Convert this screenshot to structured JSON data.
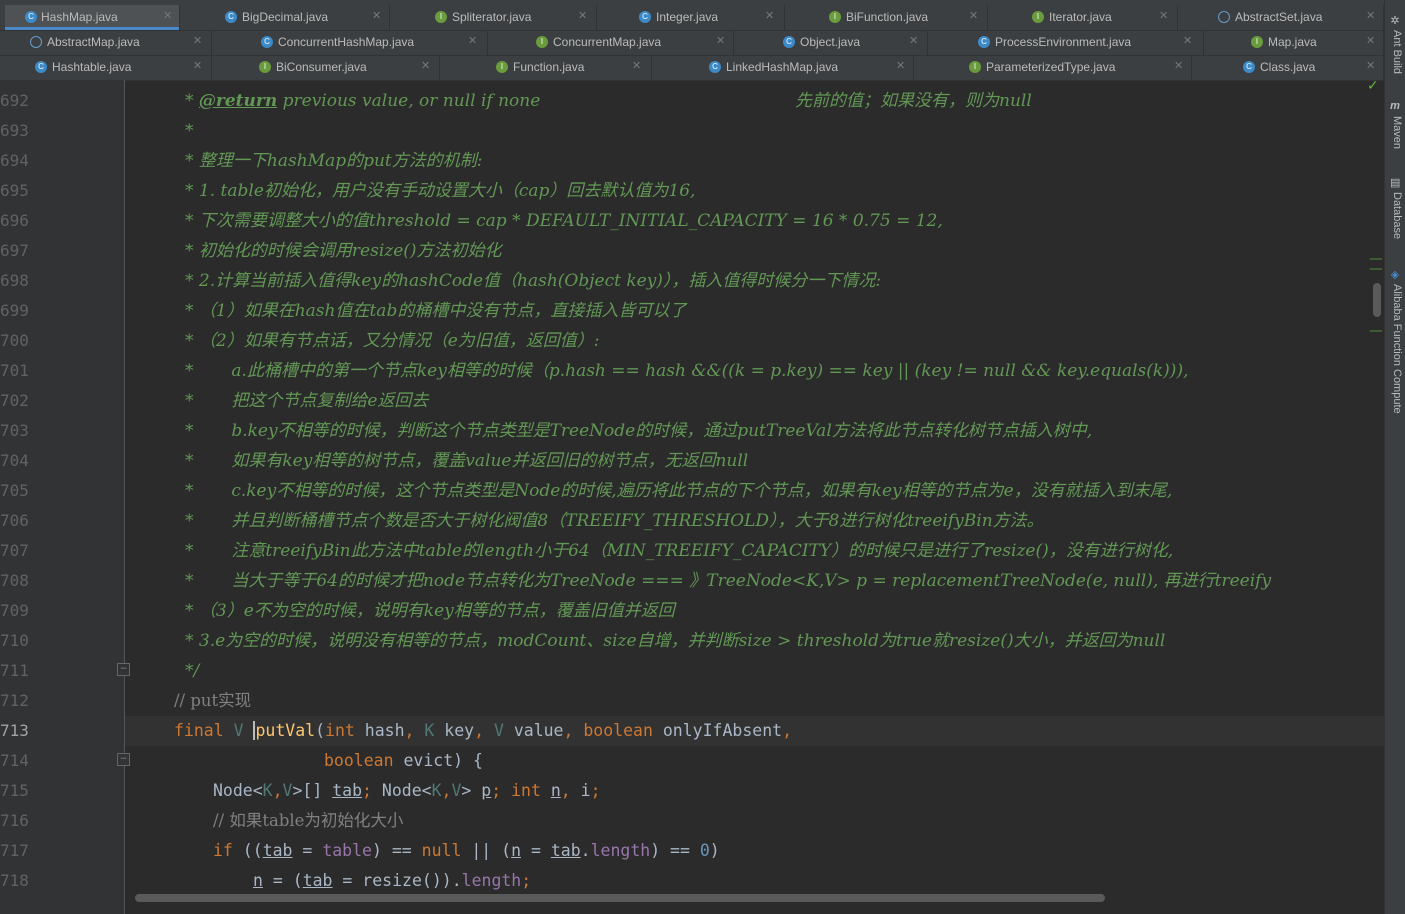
{
  "tabs": {
    "row1": [
      {
        "label": "HashMap.java",
        "icon": "class-icon",
        "active": true
      },
      {
        "label": "BigDecimal.java",
        "icon": "class-icon"
      },
      {
        "label": "Spliterator.java",
        "icon": "interface-icon"
      },
      {
        "label": "Integer.java",
        "icon": "class-icon"
      },
      {
        "label": "BiFunction.java",
        "icon": "interface-icon"
      },
      {
        "label": "Iterator.java",
        "icon": "interface-icon"
      },
      {
        "label": "AbstractSet.java",
        "icon": "abstract-class-icon"
      }
    ],
    "row2": [
      {
        "label": "AbstractMap.java",
        "icon": "abstract-class-icon"
      },
      {
        "label": "ConcurrentHashMap.java",
        "icon": "class-icon"
      },
      {
        "label": "ConcurrentMap.java",
        "icon": "interface-icon"
      },
      {
        "label": "Object.java",
        "icon": "class-icon"
      },
      {
        "label": "ProcessEnvironment.java",
        "icon": "class-icon"
      },
      {
        "label": "Map.java",
        "icon": "interface-icon"
      }
    ],
    "row3": [
      {
        "label": "Hashtable.java",
        "icon": "class-icon"
      },
      {
        "label": "BiConsumer.java",
        "icon": "interface-icon"
      },
      {
        "label": "Function.java",
        "icon": "interface-icon"
      },
      {
        "label": "LinkedHashMap.java",
        "icon": "class-icon"
      },
      {
        "label": "ParameterizedType.java",
        "icon": "interface-icon"
      },
      {
        "label": "Class.java",
        "icon": "class-icon"
      }
    ]
  },
  "tool_windows": [
    {
      "label": "Ant Build",
      "icon": "ant-icon"
    },
    {
      "label": "Maven",
      "icon": "maven-icon"
    },
    {
      "label": "Database",
      "icon": "database-icon"
    },
    {
      "label": "Alibaba Function Compute",
      "icon": "alibaba-icon"
    }
  ],
  "line_numbers": [
    "692",
    "693",
    "694",
    "695",
    "696",
    "697",
    "698",
    "699",
    "700",
    "701",
    "702",
    "703",
    "704",
    "705",
    "706",
    "707",
    "708",
    "709",
    "710",
    "711",
    "712",
    "713",
    "714",
    "715",
    "716",
    "717",
    "718"
  ],
  "current_line": "713",
  "doc_comment": {
    "l692_tag": "@return",
    "l692_text": " previous value, or null if none",
    "l692_cn": "先前的值；如果没有，则为null",
    "l693": "*",
    "l694": "* 整理一下hashMap的put方法的机制:",
    "l695": "* 1. table初始化，用户没有手动设置大小（cap）回去默认值为16,",
    "l696": "* 下次需要调整大小的值threshold = cap * DEFAULT_INITIAL_CAPACITY = 16 * 0.75 = 12,",
    "l697": "* 初始化的时候会调用resize()方法初始化",
    "l698": "* 2.计算当前插入值得key的hashCode值（hash(Object key)），插入值得时候分一下情况:",
    "l699": "* （1）如果在hash值在tab的桶槽中没有节点，直接插入皆可以了",
    "l700": "* （2）如果有节点话，又分情况（e为旧值，返回值）:",
    "l701": "*       a.此桶槽中的第一个节点key相等的时候（p.hash == hash &&((k = p.key) == key || (key != null && key.equals(k))),",
    "l702": "*       把这个节点复制给e返回去",
    "l703": "*       b.key不相等的时候，判断这个节点类型是TreeNode的时候，通过putTreeVal方法将此节点转化树节点插入树中,",
    "l704": "*       如果有key相等的树节点，覆盖value并返回旧的树节点，无返回null",
    "l705": "*       c.key不相等的时候，这个节点类型是Node的时候,遍历将此节点的下个节点，如果有key相等的节点为e，没有就插入到末尾,",
    "l706": "*       并且判断桶槽节点个数是否大于树化阀值8（TREEIFY_THRESHOLD），大于8进行树化treeifyBin方法。",
    "l707": "*       注意treeifyBin此方法中table的length小于64（MIN_TREEIFY_CAPACITY）的时候只是进行了resize()，没有进行树化,",
    "l708": "*       当大于等于64的时候才把node节点转化为TreeNode === 》TreeNode<K,V> p = replacementTreeNode(e, null), 再进行treeify",
    "l709": "* （3）e不为空的时候，说明有key相等的节点，覆盖旧值并返回",
    "l710": "* 3.e为空的时候，说明没有相等的节点，modCount、size自增，并判断size > threshold为true就resize()大小，并返回为null",
    "l711": "*/"
  },
  "code": {
    "l712": "// put实现",
    "l716": "// 如果table为初始化大小"
  },
  "colors": {
    "background": "#2b2b2b",
    "doc_comment": "#629755",
    "keyword": "#cc7832",
    "function": "#ffc66d",
    "field": "#9876aa",
    "number": "#6897bb",
    "comment": "#808080",
    "tab_active_accent": "#4a88c7"
  }
}
